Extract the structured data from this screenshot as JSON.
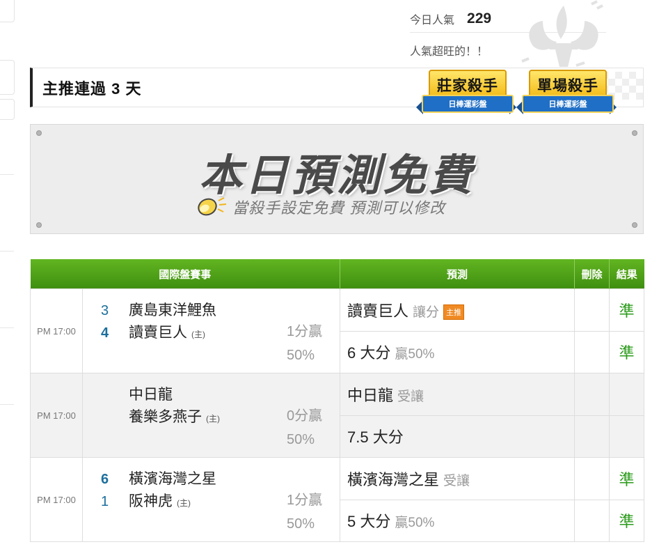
{
  "popularity": {
    "label": "今日人氣",
    "count": "229",
    "subtitle": "人氣超旺的！！"
  },
  "streak": {
    "title": "主推連過 3 天"
  },
  "badges": [
    {
      "title": "莊家殺手",
      "ribbon": "日棒運彩盤",
      "colors": {
        "fill": "#f3b812",
        "ribbon": "#1f6fc6"
      }
    },
    {
      "title": "單場殺手",
      "ribbon": "日棒運彩盤",
      "colors": {
        "fill": "#f3b812",
        "ribbon": "#1f6fc6"
      }
    }
  ],
  "banner": {
    "title": "本日預測免費",
    "subtitle": "當殺手設定免費  預測可以修改",
    "icon": "lightbulb-icon"
  },
  "table": {
    "headers": {
      "match": "國際盤賽事",
      "prediction": "預測",
      "delete": "刪除",
      "result": "結果"
    },
    "games": [
      {
        "time": "PM 17:00",
        "team1": {
          "score": "3",
          "name": "廣島東洋鯉魚",
          "host": ""
        },
        "team2": {
          "score": "4",
          "name": "讀賣巨人",
          "host": "(主)"
        },
        "odds": {
          "line1": "1分贏",
          "line2": "50%"
        },
        "pred1": {
          "main": "讀賣巨人",
          "sub": "讓分",
          "tag": "主推"
        },
        "pred2": {
          "main": "6 大分",
          "sub": "贏50%"
        },
        "result1": "準",
        "result2": "準"
      },
      {
        "time": "PM 17:00",
        "team1": {
          "score": "",
          "name": "中日龍",
          "host": ""
        },
        "team2": {
          "score": "",
          "name": "養樂多燕子",
          "host": "(主)"
        },
        "odds": {
          "line1": "0分贏",
          "line2": "50%"
        },
        "pred1": {
          "main": "中日龍",
          "sub": "受讓"
        },
        "pred2": {
          "main": "7.5 大分",
          "sub": ""
        },
        "result1": "",
        "result2": ""
      },
      {
        "time": "PM 17:00",
        "team1": {
          "score": "6",
          "name": "橫濱海灣之星",
          "host": ""
        },
        "team2": {
          "score": "1",
          "name": "阪神虎",
          "host": "(主)"
        },
        "odds": {
          "line1": "1分贏",
          "line2": "50%"
        },
        "pred1": {
          "main": "橫濱海灣之星",
          "sub": "受讓"
        },
        "pred2": {
          "main": "5 大分",
          "sub": "贏50%"
        },
        "result1": "準",
        "result2": "準"
      }
    ]
  },
  "colors": {
    "header_green": "#4fa118",
    "result_green": "#2a9a1a",
    "score_blue": "#1c6f9c"
  }
}
